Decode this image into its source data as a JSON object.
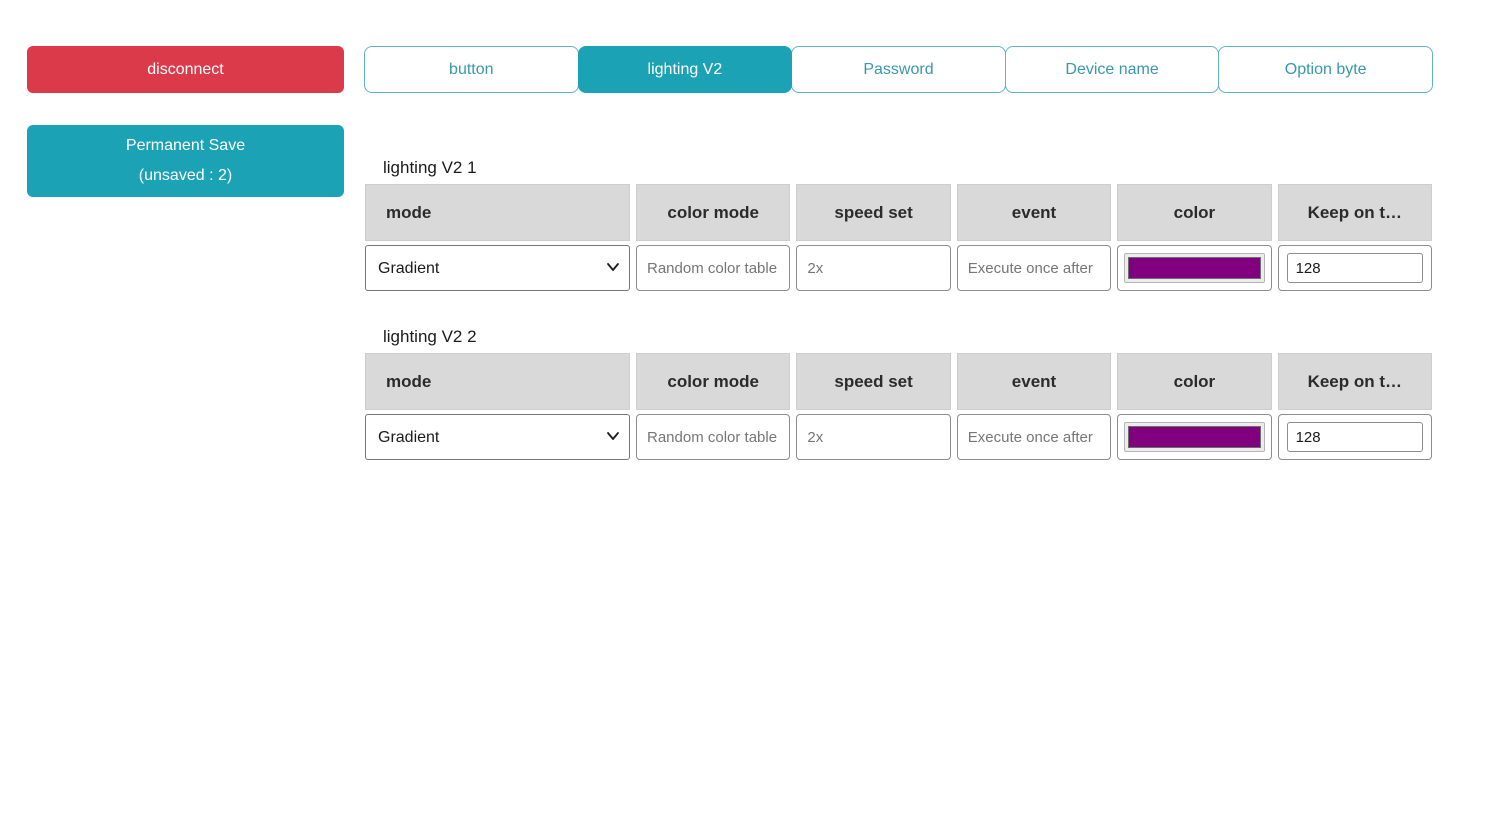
{
  "palette": {
    "accent_teal": "#1ba3b5",
    "danger_red": "#db3a4b",
    "tab_text_teal": "#3898ac",
    "table_header_bg": "#d9d9d9",
    "swatch_purple": "#800080"
  },
  "toolbar": {
    "disconnect_label": "disconnect",
    "save_line1": "Permanent Save",
    "save_line2": "(unsaved : 2)"
  },
  "tabs": [
    {
      "label": "button",
      "active": false
    },
    {
      "label": "lighting V2",
      "active": true
    },
    {
      "label": "Password",
      "active": false
    },
    {
      "label": "Device name",
      "active": false
    },
    {
      "label": "Option byte",
      "active": false
    }
  ],
  "sections": [
    {
      "title": "lighting V2 1",
      "columns": [
        "mode",
        "color mode",
        "speed set",
        "event",
        "color",
        "Keep on t…"
      ],
      "row": {
        "mode": "Gradient",
        "color_mode": "Random color table",
        "speed_set": "2x",
        "event": "Execute once after",
        "color": "#800080",
        "keep_on": "128"
      }
    },
    {
      "title": "lighting V2 2",
      "columns": [
        "mode",
        "color mode",
        "speed set",
        "event",
        "color",
        "Keep on t…"
      ],
      "row": {
        "mode": "Gradient",
        "color_mode": "Random color table",
        "speed_set": "2x",
        "event": "Execute once after",
        "color": "#800080",
        "keep_on": "128"
      }
    }
  ]
}
